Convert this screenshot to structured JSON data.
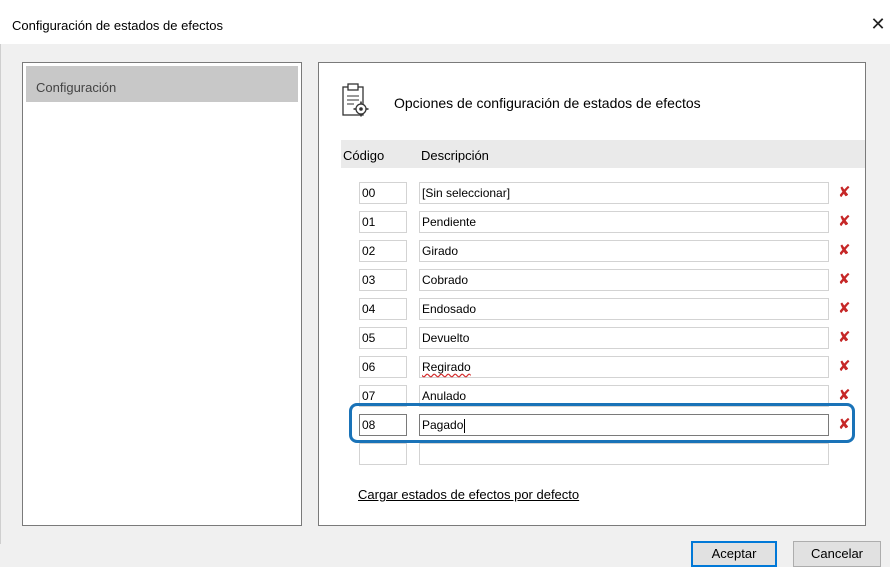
{
  "window": {
    "title": "Configuración de estados de efectos",
    "close_glyph": "✕"
  },
  "nav": {
    "items": [
      {
        "label": "Configuración",
        "selected": true
      }
    ]
  },
  "panel": {
    "header_icon": "settings-document-icon",
    "header_text": "Opciones de configuración de estados de efectos",
    "columns": {
      "code": "Código",
      "description": "Descripción"
    },
    "rows": [
      {
        "code": "00",
        "description": "[Sin seleccionar]"
      },
      {
        "code": "01",
        "description": "Pendiente"
      },
      {
        "code": "02",
        "description": "Girado"
      },
      {
        "code": "03",
        "description": "Cobrado"
      },
      {
        "code": "04",
        "description": "Endosado"
      },
      {
        "code": "05",
        "description": "Devuelto"
      },
      {
        "code": "06",
        "description": "Regirado"
      },
      {
        "code": "07",
        "description": "Anulado"
      },
      {
        "code": "08",
        "description": "Pagado"
      },
      {
        "code": "",
        "description": ""
      }
    ],
    "delete_glyph": "✘",
    "load_defaults_link": "Cargar estados de efectos por defecto"
  },
  "buttons": {
    "ok": "Aceptar",
    "cancel": "Cancelar"
  },
  "colors": {
    "highlight": "#1a73b8",
    "delete": "#c62828",
    "selected_nav": "#c8c8c8"
  }
}
